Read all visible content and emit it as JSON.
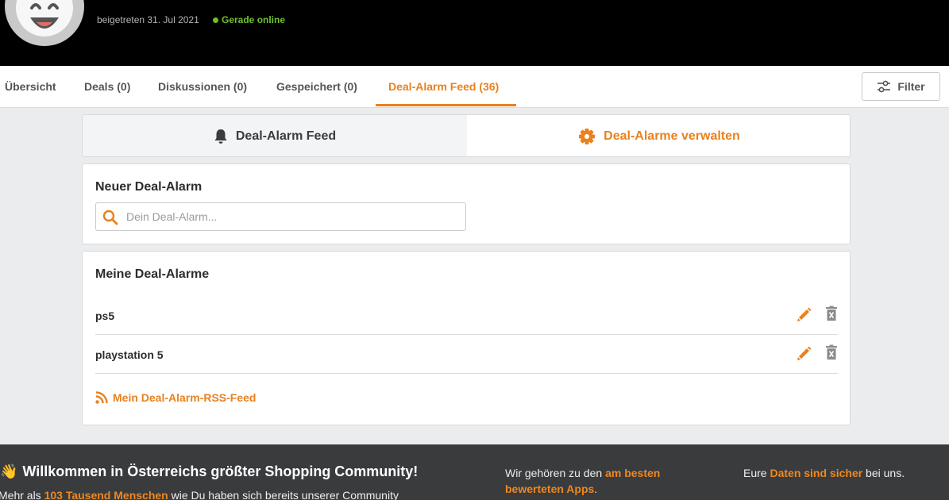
{
  "profile": {
    "joined": "beigetreten 31. Jul 2021",
    "status": "Gerade online"
  },
  "tabs": [
    {
      "label": "Übersicht",
      "active": false
    },
    {
      "label": "Deals (0)",
      "active": false
    },
    {
      "label": "Diskussionen (0)",
      "active": false
    },
    {
      "label": "Gespeichert (0)",
      "active": false
    },
    {
      "label": "Deal-Alarm Feed (36)",
      "active": true
    }
  ],
  "filter": {
    "label": "Filter"
  },
  "switcher": {
    "feed_label": "Deal-Alarm Feed",
    "manage_label": "Deal-Alarme verwalten"
  },
  "new_alarm": {
    "title": "Neuer Deal-Alarm",
    "placeholder": "Dein Deal-Alarm..."
  },
  "my_alarms": {
    "title": "Meine Deal-Alarme",
    "items": [
      {
        "name": "ps5"
      },
      {
        "name": "playstation 5"
      }
    ],
    "rss_label": "Mein Deal-Alarm-RSS-Feed"
  },
  "footer": {
    "title": "Willkommen in Österreichs größter Shopping Community!",
    "sub_pre": "Mehr als ",
    "sub_hl": "103 Tausend Menschen",
    "sub_post": " wie Du haben sich bereits unserer Community",
    "col2_pre": "Wir gehören zu den ",
    "col2_hl": "am besten bewerteten Apps",
    "col2_post": ".",
    "col3_pre": "Eure ",
    "col3_hl": "Daten sind sicher",
    "col3_post": " bei uns."
  },
  "colors": {
    "accent": "#e8811e",
    "online": "#6fc02a",
    "header_bg": "#000000",
    "footer_bg": "#3a3b3d"
  }
}
